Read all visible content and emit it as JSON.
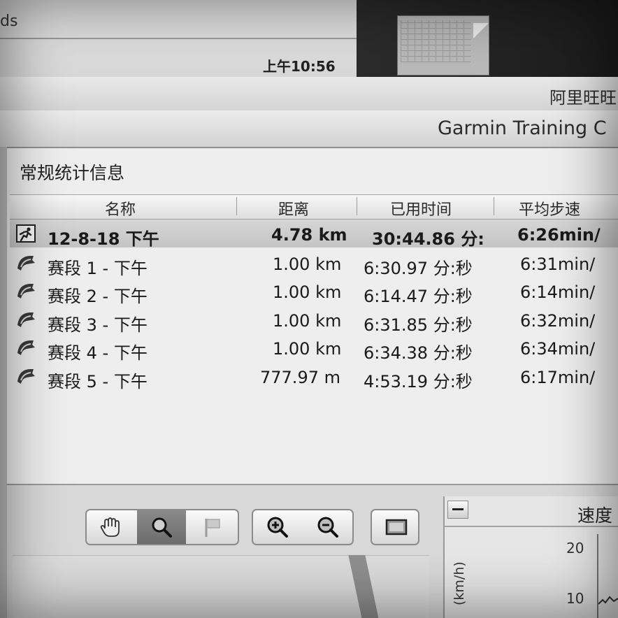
{
  "background_window": {
    "edge_text": "ds",
    "clock": "上午10:56"
  },
  "ali_window": {
    "title": "阿里旺旺"
  },
  "garmin_window": {
    "title": "Garmin Training C"
  },
  "section": {
    "title": "常规统计信息"
  },
  "table": {
    "headers": {
      "name": "名称",
      "distance": "距离",
      "elapsed": "已用时间",
      "pace": "平均步速"
    },
    "summary": {
      "icon": "running-activity-icon",
      "name": "12-8-18 下午",
      "distance": "4.78 km",
      "elapsed": "30:44.86 分:",
      "pace": "6:26min/"
    },
    "laps": [
      {
        "icon": "lap-flag-icon",
        "name": "赛段 1 - 下午",
        "distance": "1.00 km",
        "elapsed": "6:30.97 分:秒",
        "pace": "6:31min/"
      },
      {
        "icon": "lap-flag-icon",
        "name": "赛段 2 - 下午",
        "distance": "1.00 km",
        "elapsed": "6:14.47 分:秒",
        "pace": "6:14min/"
      },
      {
        "icon": "lap-flag-icon",
        "name": "赛段 3 - 下午",
        "distance": "1.00 km",
        "elapsed": "6:31.85 分:秒",
        "pace": "6:32min/"
      },
      {
        "icon": "lap-flag-icon",
        "name": "赛段 4 - 下午",
        "distance": "1.00 km",
        "elapsed": "6:34.38 分:秒",
        "pace": "6:34min/"
      },
      {
        "icon": "lap-flag-icon",
        "name": "赛段 5 - 下午",
        "distance": "777.97 m",
        "elapsed": "4:53.19 分:秒",
        "pace": "6:17min/"
      }
    ]
  },
  "toolbar": {
    "tools": [
      "hand-pan-icon",
      "magnifier-icon",
      "flag-icon",
      "zoom-in-icon",
      "zoom-out-icon",
      "fit-to-window-icon"
    ],
    "active_tool": "magnifier-icon"
  },
  "chart": {
    "title": "速度",
    "ylabel": "(km/h)",
    "ticks": [
      "20",
      "10"
    ]
  }
}
